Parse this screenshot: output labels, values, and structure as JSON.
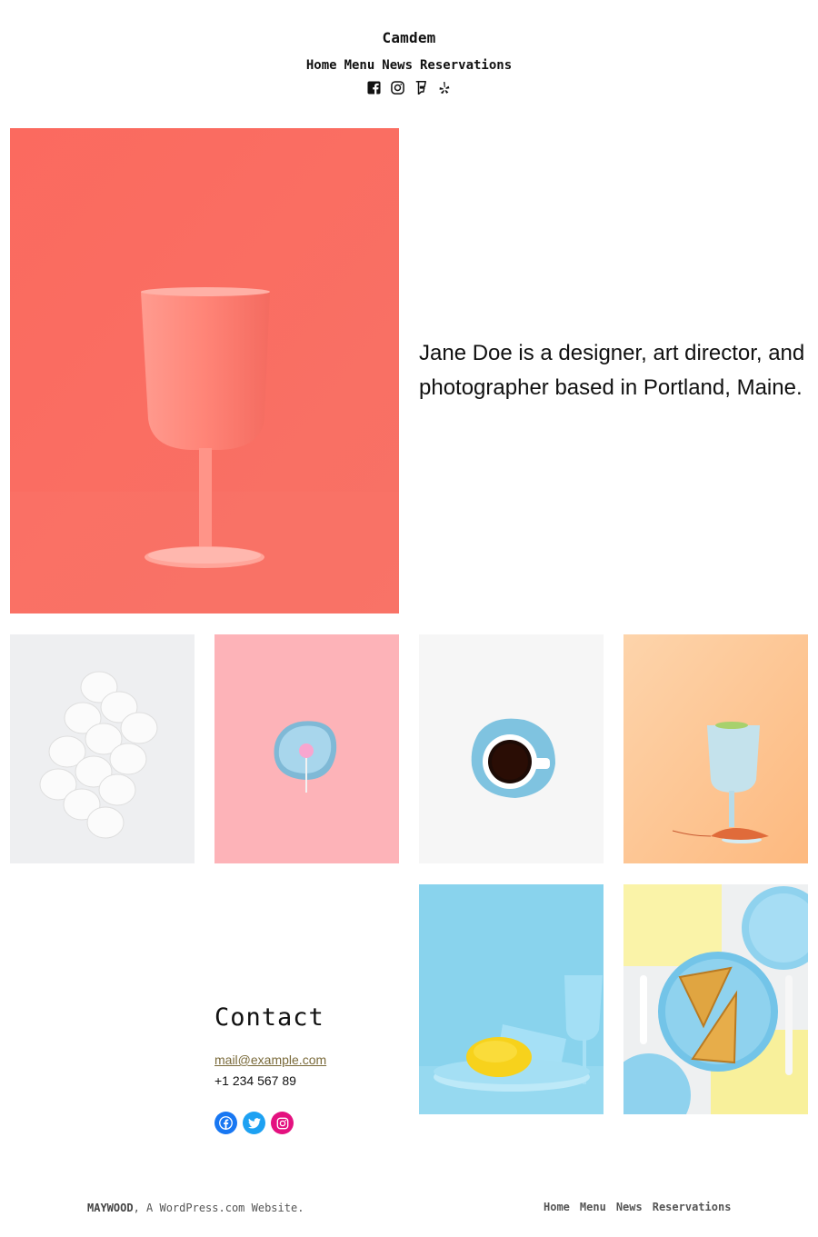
{
  "header": {
    "site_title": "Camdem",
    "nav": [
      "Home",
      "Menu",
      "News",
      "Reservations"
    ],
    "social_icons": [
      "facebook-icon",
      "instagram-icon",
      "foursquare-icon",
      "yelp-icon"
    ]
  },
  "intro": {
    "text": "Jane Doe is a designer, art director, and photographer based in Portland, Maine."
  },
  "gallery": {
    "hero": "red-wine-glass-photo",
    "items": [
      "eggs-photo",
      "lollipop-plate-photo",
      "coffee-cup-photo",
      "glass-shrimp-photo",
      "lemon-glassware-photo",
      "waffles-plate-photo"
    ]
  },
  "contact": {
    "heading": "Contact",
    "email": "mail@example.com",
    "phone": "+1 234 567 89",
    "social_icons": [
      "facebook-icon",
      "twitter-icon",
      "instagram-icon"
    ],
    "colors": {
      "facebook": "#1877f2",
      "twitter": "#1da1f2",
      "instagram": "#e4117f"
    }
  },
  "footer": {
    "site_name": "MAYWOOD",
    "credit_suffix": ", A WordPress.com Website.",
    "nav": [
      "Home",
      "Menu",
      "News",
      "Reservations"
    ]
  }
}
